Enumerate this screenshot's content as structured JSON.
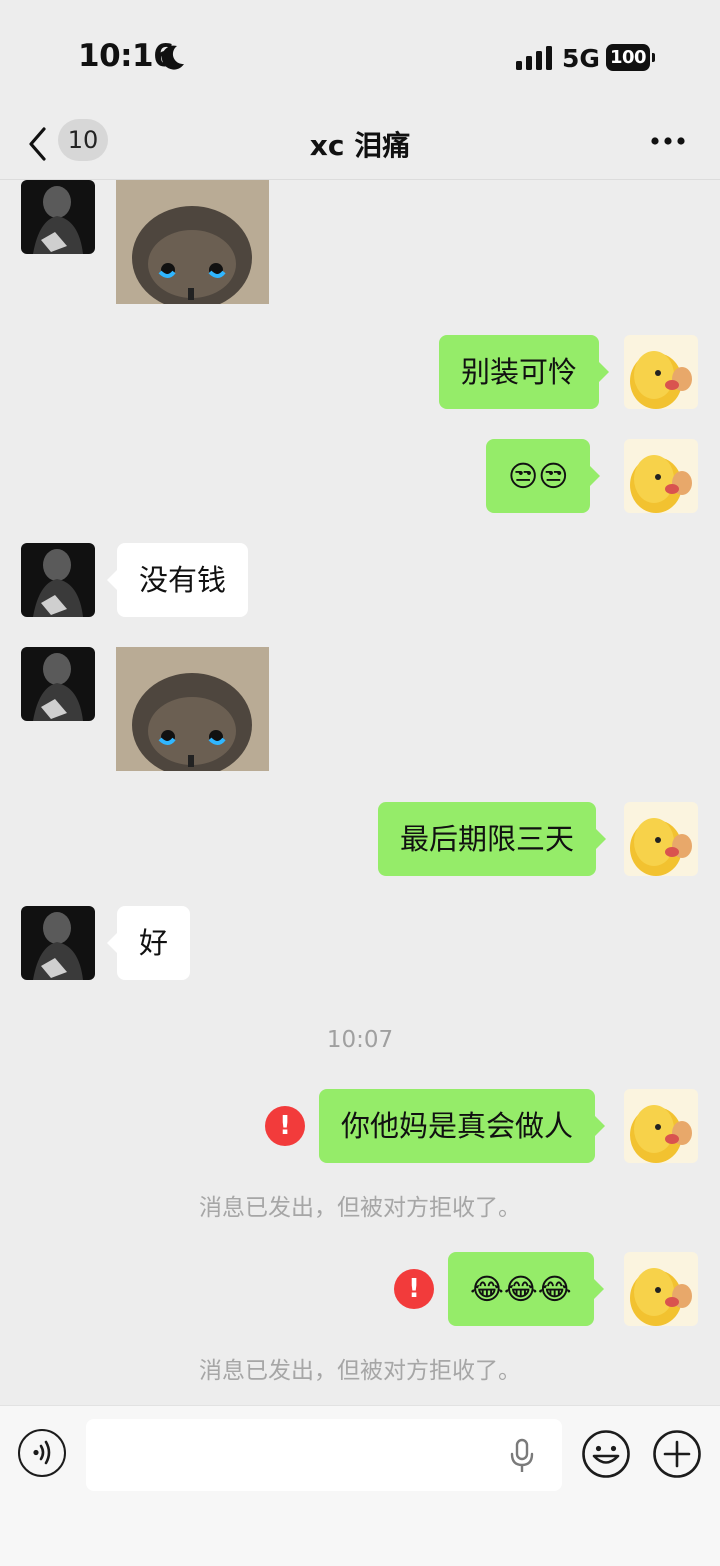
{
  "status_bar": {
    "time": "10:16",
    "network": "5G",
    "battery": "100"
  },
  "nav": {
    "back_badge": "10",
    "title": "xc 泪痛",
    "more_icon": "more-icon"
  },
  "messages": [
    {
      "id": "m1",
      "side": "left",
      "type": "sticker",
      "content": "crying-cat-sticker"
    },
    {
      "id": "m2",
      "side": "right",
      "type": "text",
      "text": "别装可怜"
    },
    {
      "id": "m3",
      "side": "right",
      "type": "text",
      "text": "😒😒"
    },
    {
      "id": "m4",
      "side": "left",
      "type": "text",
      "text": "没有钱"
    },
    {
      "id": "m5",
      "side": "left",
      "type": "sticker",
      "content": "crying-cat-sticker"
    },
    {
      "id": "m6",
      "side": "right",
      "type": "text",
      "text": "最后期限三天"
    },
    {
      "id": "m7",
      "side": "left",
      "type": "text",
      "text": "好"
    },
    {
      "id": "t1",
      "type": "timestamp",
      "text": "10:07"
    },
    {
      "id": "m8",
      "side": "right",
      "type": "text",
      "text": "你他妈是真会做人",
      "status": "failed"
    },
    {
      "id": "n1",
      "type": "system",
      "text": "消息已发出，但被对方拒收了。"
    },
    {
      "id": "m9",
      "side": "right",
      "type": "text",
      "text": "😂😂😂",
      "status": "failed"
    },
    {
      "id": "n2",
      "type": "system",
      "text": "消息已发出，但被对方拒收了。"
    }
  ],
  "error_mark": "!",
  "input": {
    "value": "",
    "placeholder": ""
  },
  "colors": {
    "background": "#ededed",
    "outgoing_bubble": "#95ec69",
    "incoming_bubble": "#ffffff",
    "error": "#f23b3b"
  }
}
